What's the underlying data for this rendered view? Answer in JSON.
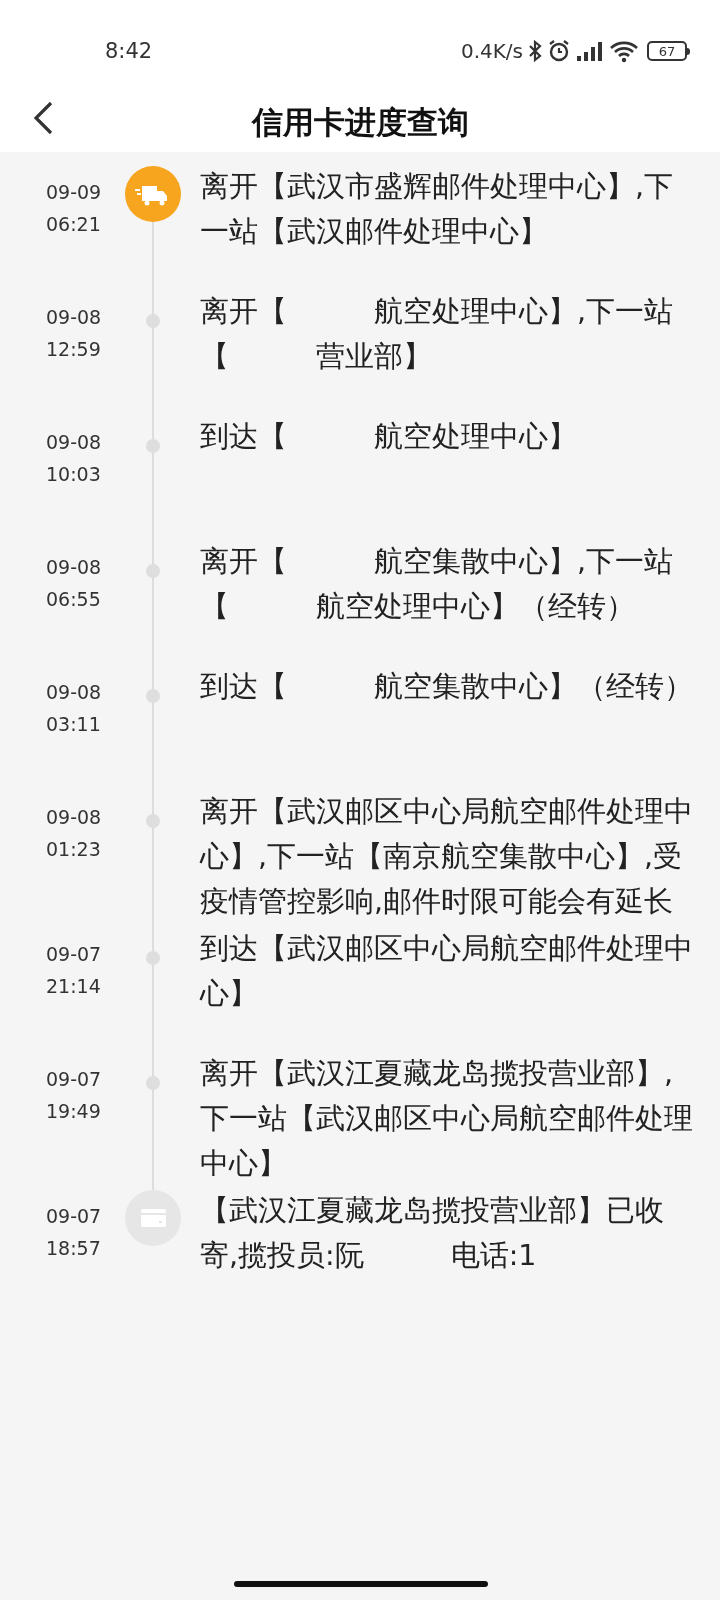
{
  "status_bar": {
    "time": "8:42",
    "net_speed": "0.4K/s",
    "battery": "67"
  },
  "header": {
    "title": "信用卡进度查询"
  },
  "timeline": [
    {
      "date": "09-09",
      "time": "06:21",
      "text": "离开【武汉市盛辉邮件处理中心】,下一站【武汉邮件处理中心】",
      "kind": "current"
    },
    {
      "date": "09-08",
      "time": "12:59",
      "text": "离开【　　　航空处理中心】,下一站【　　　营业部】",
      "kind": "step"
    },
    {
      "date": "09-08",
      "time": "10:03",
      "text": "到达【　　　航空处理中心】",
      "kind": "step"
    },
    {
      "date": "09-08",
      "time": "06:55",
      "text": "离开【　　　航空集散中心】,下一站【　　　航空处理中心】（经转）",
      "kind": "step"
    },
    {
      "date": "09-08",
      "time": "03:11",
      "text": "到达【　　　航空集散中心】（经转）",
      "kind": "step"
    },
    {
      "date": "09-08",
      "time": "01:23",
      "text": "离开【武汉邮区中心局航空邮件处理中心】,下一站【南京航空集散中心】,受疫情管控影响,邮件时限可能会有延长",
      "kind": "step"
    },
    {
      "date": "09-07",
      "time": "21:14",
      "text": "到达【武汉邮区中心局航空邮件处理中心】",
      "kind": "step"
    },
    {
      "date": "09-07",
      "time": "19:49",
      "text": "离开【武汉江夏藏龙岛揽投营业部】,下一站【武汉邮区中心局航空邮件处理中心】",
      "kind": "step"
    },
    {
      "date": "09-07",
      "time": "18:57",
      "text": "【武汉江夏藏龙岛揽投营业部】已收寄,揽投员:阮　　　电话:1",
      "kind": "origin"
    }
  ]
}
